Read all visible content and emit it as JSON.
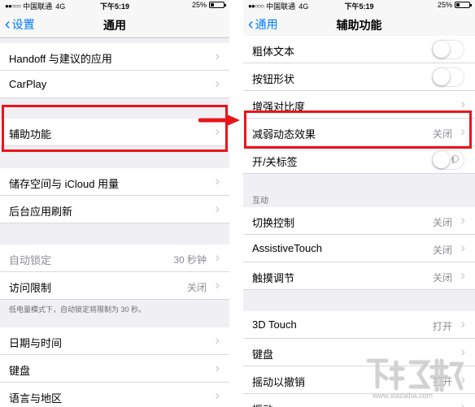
{
  "left": {
    "status": {
      "signal": "●●○○○",
      "carrier": "中国联通",
      "network": "4G",
      "time": "下午5:19",
      "battery_pct": "25%",
      "battery_level": 0.25
    },
    "nav": {
      "back": "设置",
      "title": "通用"
    },
    "rows": {
      "handoff": "Handoff 与建议的应用",
      "carplay": "CarPlay",
      "accessibility": "辅助功能",
      "storage": "储存空间与 iCloud 用量",
      "bg_refresh": "后台应用刷新",
      "auto_lock": {
        "label": "自动锁定",
        "value": "30 秒钟"
      },
      "restrictions": {
        "label": "访问限制",
        "value": "关闭"
      },
      "date_time": "日期与时间",
      "keyboard": "键盘",
      "language": "语言与地区"
    },
    "low_power_note": "低电量模式下，自动锁定将限制为 30 秒。"
  },
  "right": {
    "status": {
      "signal": "●●○○○",
      "carrier": "中国联通",
      "network": "4G",
      "time": "下午5:19",
      "battery_pct": "25%",
      "battery_level": 0.25
    },
    "nav": {
      "back": "通用",
      "title": "辅助功能"
    },
    "rows": {
      "bold_text": {
        "label": "粗体文本",
        "on": false
      },
      "button_shapes": {
        "label": "按钮形状",
        "on": false
      },
      "increase_contrast": "增强对比度",
      "reduce_motion": {
        "label": "减弱动态效果",
        "value": "关闭"
      },
      "on_off_labels": {
        "label": "开/关标签",
        "on": false
      },
      "switch_control": {
        "label": "切换控制",
        "value": "关闭"
      },
      "assistive_touch": {
        "label": "AssistiveTouch",
        "value": "关闭"
      },
      "touch_accommodations": {
        "label": "触摸调节",
        "value": "关闭"
      },
      "touch_3d": {
        "label": "3D Touch",
        "value": "打开"
      },
      "keyboard": "键盘",
      "shake_undo": {
        "label": "摇动以撤销",
        "value": "打开"
      },
      "vibration": "振动"
    },
    "interaction_header": "互动"
  },
  "annotations": {
    "highlight_color": "#e8151b",
    "arrow_color": "#e8151b"
  },
  "watermark": {
    "logo": "下载吧 logo",
    "url": "www.xiazaiba.com"
  },
  "colors": {
    "ios_blue": "#007aff",
    "background": "#efeff4",
    "secondary_text": "#8e8e93"
  }
}
